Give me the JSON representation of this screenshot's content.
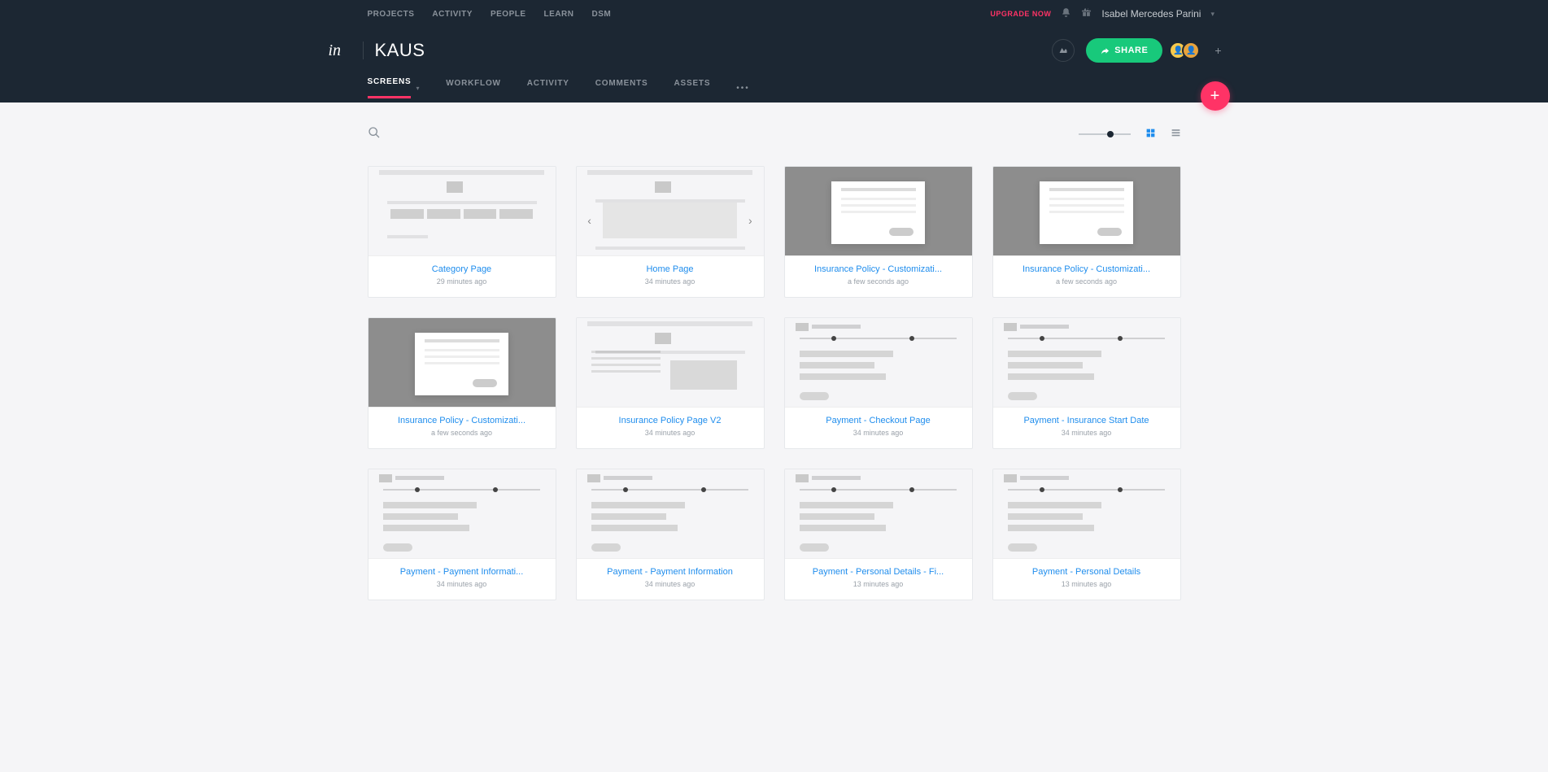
{
  "topnav": {
    "projects": "PROJECTS",
    "activity": "ACTIVITY",
    "people": "PEOPLE",
    "learn": "LEARN",
    "dsm": "DSM"
  },
  "topright": {
    "upgrade": "UPGRADE NOW",
    "username": "Isabel Mercedes Parini"
  },
  "logo": "in",
  "project_title": "KAUS",
  "share_label": "SHARE",
  "tabs": {
    "screens": "SCREENS",
    "workflow": "WORKFLOW",
    "activity": "ACTIVITY",
    "comments": "COMMENTS",
    "assets": "ASSETS",
    "more": "•••"
  },
  "screens": [
    {
      "title": "Category Page",
      "time": "29 minutes ago",
      "thumb": "category"
    },
    {
      "title": "Home Page",
      "time": "34 minutes ago",
      "thumb": "home"
    },
    {
      "title": "Insurance Policy - Customizati...",
      "time": "a few seconds ago",
      "thumb": "modal-dark"
    },
    {
      "title": "Insurance Policy - Customizati...",
      "time": "a few seconds ago",
      "thumb": "modal-dark"
    },
    {
      "title": "Insurance Policy - Customizati...",
      "time": "a few seconds ago",
      "thumb": "modal-dark"
    },
    {
      "title": "Insurance Policy Page V2",
      "time": "34 minutes ago",
      "thumb": "policy"
    },
    {
      "title": "Payment - Checkout Page",
      "time": "34 minutes ago",
      "thumb": "checkout"
    },
    {
      "title": "Payment - Insurance Start Date",
      "time": "34 minutes ago",
      "thumb": "checkout"
    },
    {
      "title": "Payment - Payment Informati...",
      "time": "34 minutes ago",
      "thumb": "checkout"
    },
    {
      "title": "Payment - Payment Information",
      "time": "34 minutes ago",
      "thumb": "checkout"
    },
    {
      "title": "Payment - Personal Details - Fi...",
      "time": "13 minutes ago",
      "thumb": "checkout"
    },
    {
      "title": "Payment - Personal Details",
      "time": "13 minutes ago",
      "thumb": "checkout"
    }
  ]
}
